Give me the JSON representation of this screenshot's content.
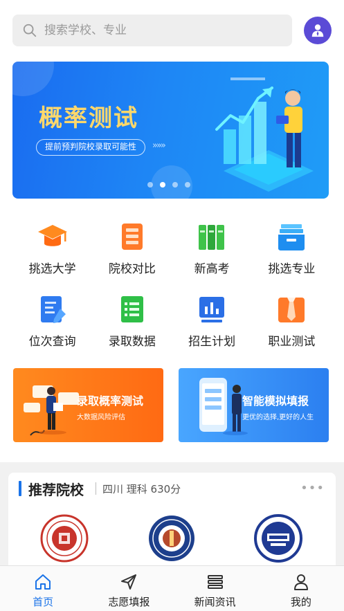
{
  "search": {
    "placeholder": "搜索学校、专业"
  },
  "banner": {
    "title": "概率测试",
    "subtitle": "提前预判院校录取可能性",
    "arrows": "»»»",
    "dot_count": 4,
    "active_dot": 1
  },
  "grid": [
    {
      "label": "挑选大学",
      "icon": "graduation-cap-icon"
    },
    {
      "label": "院校对比",
      "icon": "compare-doc-icon"
    },
    {
      "label": "新高考",
      "icon": "books-icon"
    },
    {
      "label": "挑选专业",
      "icon": "tray-icon"
    },
    {
      "label": "位次查询",
      "icon": "edit-doc-icon"
    },
    {
      "label": "录取数据",
      "icon": "list-doc-icon"
    },
    {
      "label": "招生计划",
      "icon": "bar-chart-icon"
    },
    {
      "label": "职业测试",
      "icon": "tie-icon"
    }
  ],
  "promos": {
    "left": {
      "title": "录取概率测试",
      "subtitle": "大数据风险评估"
    },
    "right": {
      "title": "智能模拟填报",
      "subtitle": "更优的选择,更好的人生"
    }
  },
  "recommend": {
    "title": "推荐院校",
    "subtitle": "四川 理科 630分",
    "more": "•••"
  },
  "tabs": [
    {
      "label": "首页",
      "icon": "home-icon",
      "active": true
    },
    {
      "label": "志愿填报",
      "icon": "send-icon",
      "active": false
    },
    {
      "label": "新闻资讯",
      "icon": "news-icon",
      "active": false
    },
    {
      "label": "我的",
      "icon": "user-icon",
      "active": false
    }
  ],
  "colors": {
    "accent": "#1a73e8",
    "banner_title": "#ffd86b",
    "avatar": "#5b4bd6",
    "promo_orange": "#ff7a18",
    "promo_blue": "#3a92f8"
  }
}
